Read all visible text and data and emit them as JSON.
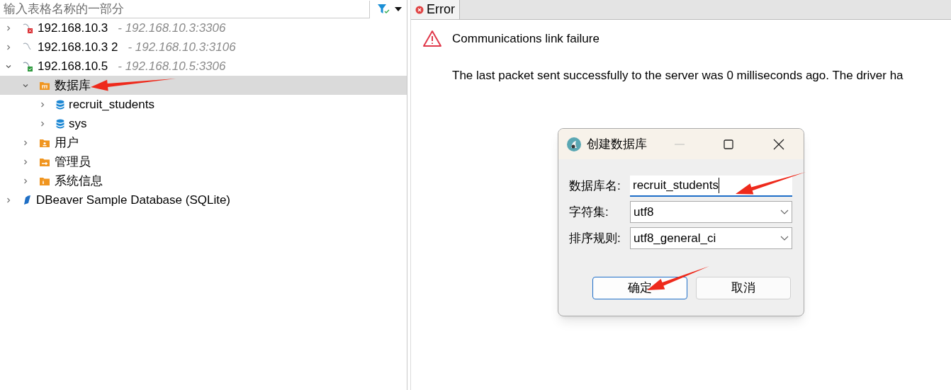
{
  "filter": {
    "placeholder": "输入表格名称的一部分"
  },
  "tree": [
    {
      "kind": "connection",
      "connected": false,
      "failed": true,
      "label": "192.168.10.3",
      "detail": "- 192.168.10.3:3306",
      "expanded": false,
      "selected": false
    },
    {
      "kind": "connection",
      "connected": false,
      "failed": false,
      "label": "192.168.10.3 2",
      "detail": "- 192.168.10.3:3106",
      "expanded": false,
      "selected": false
    },
    {
      "kind": "connection",
      "connected": true,
      "failed": false,
      "label": "192.168.10.5",
      "detail": "- 192.168.10.5:3306",
      "expanded": true,
      "selected": false,
      "children": [
        {
          "kind": "folder",
          "label": "数据库",
          "expanded": true,
          "selected": true,
          "children": [
            {
              "kind": "database",
              "label": "recruit_students",
              "expanded": false,
              "selected": false
            },
            {
              "kind": "database",
              "label": "sys",
              "expanded": false,
              "selected": false
            }
          ]
        },
        {
          "kind": "folder",
          "label": "用户",
          "expanded": false,
          "selected": false
        },
        {
          "kind": "folder",
          "label": "管理员",
          "expanded": false,
          "selected": false
        },
        {
          "kind": "folder",
          "label": "系统信息",
          "expanded": false,
          "selected": false
        }
      ]
    },
    {
      "kind": "sqlite",
      "label": "DBeaver Sample Database (SQLite)",
      "expanded": false,
      "selected": false
    }
  ],
  "tabs": [
    {
      "label": "Error",
      "selected": true
    }
  ],
  "error": {
    "title": "Communications link failure",
    "message": "The last packet sent successfully to the server was 0 milliseconds ago. The driver ha"
  },
  "dialog": {
    "title": "创建数据库",
    "fields": [
      {
        "kind": "input",
        "label": "数据库名:",
        "value": "recruit_students",
        "focused": true
      },
      {
        "kind": "select",
        "label": "字符集:",
        "value": "utf8",
        "focused": false
      },
      {
        "kind": "select",
        "label": "排序规则:",
        "value": "utf8_general_ci",
        "focused": false
      }
    ],
    "buttons": [
      {
        "label": "确定",
        "default": true
      },
      {
        "label": "取消",
        "default": false
      }
    ]
  }
}
